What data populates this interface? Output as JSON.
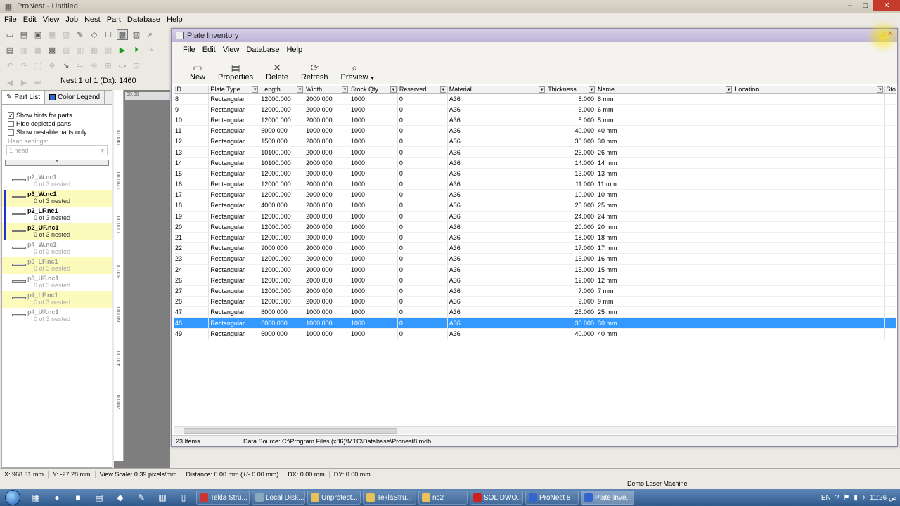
{
  "app": {
    "title": "ProNest - Untitled",
    "menu": [
      "File",
      "Edit",
      "View",
      "Job",
      "Nest",
      "Part",
      "Database",
      "Help"
    ],
    "nest_label": "Nest 1 of 1 (Dx): 1460",
    "window_controls": [
      "–",
      "□",
      "✕"
    ]
  },
  "left_panel": {
    "tabs": [
      "Part List",
      "Color Legend"
    ],
    "checkboxes": [
      {
        "label": "Show hints for parts",
        "checked": true
      },
      {
        "label": "Hide depleted parts",
        "checked": false
      },
      {
        "label": "Show nestable parts only",
        "checked": false
      }
    ],
    "head_settings_label": "Head settings:",
    "head_settings_value": "1 head",
    "parts": [
      {
        "name": "p2_W.nc1",
        "status": "0 of 3 nested"
      },
      {
        "name": "p3_W.nc1",
        "status": "0 of 3 nested"
      },
      {
        "name": "p2_LF.nc1",
        "status": "0 of 3 nested"
      },
      {
        "name": "p2_UF.nc1",
        "status": "0 of 3 nested"
      },
      {
        "name": "p4_W.nc1",
        "status": "0 of 3 nested"
      },
      {
        "name": "p3_LF.nc1",
        "status": "0 of 3 nested"
      },
      {
        "name": "p3_UF.nc1",
        "status": "0 of 3 nested"
      },
      {
        "name": "p4_LF.nc1",
        "status": "0 of 3 nested"
      },
      {
        "name": "p4_UF.nc1",
        "status": "0 of 3 nested"
      }
    ]
  },
  "ruler": {
    "ticks": [
      "1400.00",
      "1200.00",
      "1000.00",
      "800.00",
      "600.00",
      "400.00",
      "200.00"
    ],
    "top_value": "00.00"
  },
  "status_bar": {
    "x": "X: 968.31 mm",
    "y": "Y: -27.28 mm",
    "view_scale": "View Scale: 0.39 pixels/mm",
    "distance": "Distance: 0.00 mm (+/- 0.00 mm)",
    "dx": "DX: 0.00 mm",
    "dy": "DY: 0.00 mm",
    "machine": "Demo Laser Machine"
  },
  "plate_inventory": {
    "title": "Plate Inventory",
    "menu": [
      "File",
      "Edit",
      "View",
      "Database",
      "Help"
    ],
    "toolbar": [
      {
        "label": "New",
        "icon": "new-icon"
      },
      {
        "label": "Properties",
        "icon": "properties-icon"
      },
      {
        "label": "Delete",
        "icon": "delete-icon"
      },
      {
        "label": "Refresh",
        "icon": "refresh-icon"
      },
      {
        "label": "Preview",
        "icon": "preview-icon"
      }
    ],
    "columns": [
      "ID",
      "Plate Type",
      "Length",
      "Width",
      "Stock Qty",
      "Reserved",
      "Material",
      "Thickness",
      "Name",
      "Location",
      "Sto"
    ],
    "rows": [
      [
        "8",
        "Rectangular",
        "12000.000",
        "2000.000",
        "1000",
        "0",
        "A36",
        "8.000",
        "8 mm",
        ""
      ],
      [
        "9",
        "Rectangular",
        "12000.000",
        "2000.000",
        "1000",
        "0",
        "A36",
        "6.000",
        "6 mm",
        ""
      ],
      [
        "10",
        "Rectangular",
        "12000.000",
        "2000.000",
        "1000",
        "0",
        "A36",
        "5.000",
        "5 mm",
        ""
      ],
      [
        "11",
        "Rectangular",
        "6000.000",
        "1000.000",
        "1000",
        "0",
        "A36",
        "40.000",
        "40 mm",
        ""
      ],
      [
        "12",
        "Rectangular",
        "1500.000",
        "2000.000",
        "1000",
        "0",
        "A36",
        "30.000",
        "30 mm",
        ""
      ],
      [
        "13",
        "Rectangular",
        "10100.000",
        "2000.000",
        "1000",
        "0",
        "A36",
        "26.000",
        "26 mm",
        ""
      ],
      [
        "14",
        "Rectangular",
        "10100.000",
        "2000.000",
        "1000",
        "0",
        "A36",
        "14.000",
        "14 mm",
        ""
      ],
      [
        "15",
        "Rectangular",
        "12000.000",
        "2000.000",
        "1000",
        "0",
        "A36",
        "13.000",
        "13 mm",
        ""
      ],
      [
        "16",
        "Rectangular",
        "12000.000",
        "2000.000",
        "1000",
        "0",
        "A36",
        "11.000",
        "11 mm",
        ""
      ],
      [
        "17",
        "Rectangular",
        "12000.000",
        "2000.000",
        "1000",
        "0",
        "A36",
        "10.000",
        "10 mm",
        ""
      ],
      [
        "18",
        "Rectangular",
        "4000.000",
        "2000.000",
        "1000",
        "0",
        "A36",
        "25.000",
        "25 mm",
        ""
      ],
      [
        "19",
        "Rectangular",
        "12000.000",
        "2000.000",
        "1000",
        "0",
        "A36",
        "24.000",
        "24 mm",
        ""
      ],
      [
        "20",
        "Rectangular",
        "12000.000",
        "2000.000",
        "1000",
        "0",
        "A36",
        "20.000",
        "20 mm",
        ""
      ],
      [
        "21",
        "Rectangular",
        "12000.000",
        "2000.000",
        "1000",
        "0",
        "A36",
        "18.000",
        "18 mm",
        ""
      ],
      [
        "22",
        "Rectangular",
        "9000.000",
        "2000.000",
        "1000",
        "0",
        "A36",
        "17.000",
        "17 mm",
        ""
      ],
      [
        "23",
        "Rectangular",
        "12000.000",
        "2000.000",
        "1000",
        "0",
        "A36",
        "16.000",
        "16 mm",
        ""
      ],
      [
        "24",
        "Rectangular",
        "12000.000",
        "2000.000",
        "1000",
        "0",
        "A36",
        "15.000",
        "15 mm",
        ""
      ],
      [
        "26",
        "Rectangular",
        "12000.000",
        "2000.000",
        "1000",
        "0",
        "A36",
        "12.000",
        "12 mm",
        ""
      ],
      [
        "27",
        "Rectangular",
        "12000.000",
        "2000.000",
        "1000",
        "0",
        "A36",
        "7.000",
        "7 mm",
        ""
      ],
      [
        "28",
        "Rectangular",
        "12000.000",
        "2000.000",
        "1000",
        "0",
        "A36",
        "9.000",
        "9 mm",
        ""
      ],
      [
        "47",
        "Rectangular",
        "6000.000",
        "1000.000",
        "1000",
        "0",
        "A36",
        "25.000",
        "25 mm",
        ""
      ],
      [
        "48",
        "Rectangular",
        "6000.000",
        "1000.000",
        "1000",
        "0",
        "A36",
        "30.000",
        "30 mm",
        ""
      ],
      [
        "49",
        "Rectangular",
        "6000.000",
        "1000.000",
        "1000",
        "0",
        "A36",
        "40.000",
        "40 mm",
        ""
      ]
    ],
    "selected_row_id": "48",
    "item_count": "23 Items",
    "data_source": "Data Source: C:\\Program Files (x86)\\MTC\\Database\\Pronest8.mdb"
  },
  "taskbar": {
    "items": [
      {
        "label": "Tekla Stru...",
        "color": "#c33"
      },
      {
        "label": "Local Disk...",
        "color": "#8ab"
      },
      {
        "label": "Unprotect...",
        "color": "#e8c15a"
      },
      {
        "label": "TeklaStru...",
        "color": "#e8c15a"
      },
      {
        "label": "nc2",
        "color": "#e8c15a"
      },
      {
        "label": "SOLIDWO...",
        "color": "#c22"
      },
      {
        "label": "ProNest 8",
        "color": "#36c"
      },
      {
        "label": "Plate Inve...",
        "color": "#36c",
        "active": true
      }
    ],
    "lang": "EN",
    "time": "11:26 ص"
  },
  "colors": {
    "selection": "#3399ff",
    "highlight_yellow": "#fdfbbb",
    "title_purple": "#bdb5d8"
  }
}
